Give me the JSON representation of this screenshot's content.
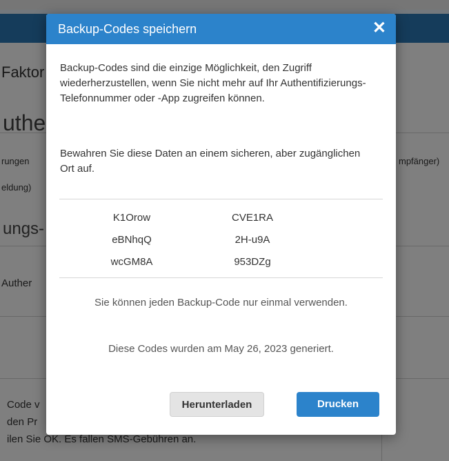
{
  "background": {
    "title_fragment": "Faktor",
    "heading_fragment": "uthe",
    "left_line1": "rungen",
    "left_line2": "eldung)",
    "right_line1": "mpfänger)",
    "sub_heading_fragment": "ungs-",
    "item_fragment": "Auther",
    "bottom_line1": "Code v",
    "bottom_line2": "den Pr",
    "bottom_line3": "ilen Sie OK. Es fallen SMS-Gebühren an."
  },
  "modal": {
    "title": "Backup-Codes speichern",
    "close_icon": "✕",
    "paragraph1": "Backup-Codes sind die einzige Möglichkeit, den Zugriff wiederherzustellen, wenn Sie nicht mehr auf Ihr Authentifizierungs-Telefonnummer oder -App zugreifen können.",
    "paragraph2": "Bewahren Sie diese Daten an einem sicheren, aber zugänglichen Ort auf.",
    "codes": [
      [
        "K1Orow",
        "CVE1RA"
      ],
      [
        "eBNhqQ",
        "2H-u9A"
      ],
      [
        "wcGM8A",
        "953DZg"
      ]
    ],
    "note1": "Sie können jeden Backup-Code nur einmal verwenden.",
    "note2": "Diese Codes wurden am May 26, 2023 generiert.",
    "download_label": "Herunterladen",
    "print_label": "Drucken"
  },
  "colors": {
    "header_blue": "#2c83cb",
    "overlay": "rgba(0,0,0,0.5)"
  }
}
